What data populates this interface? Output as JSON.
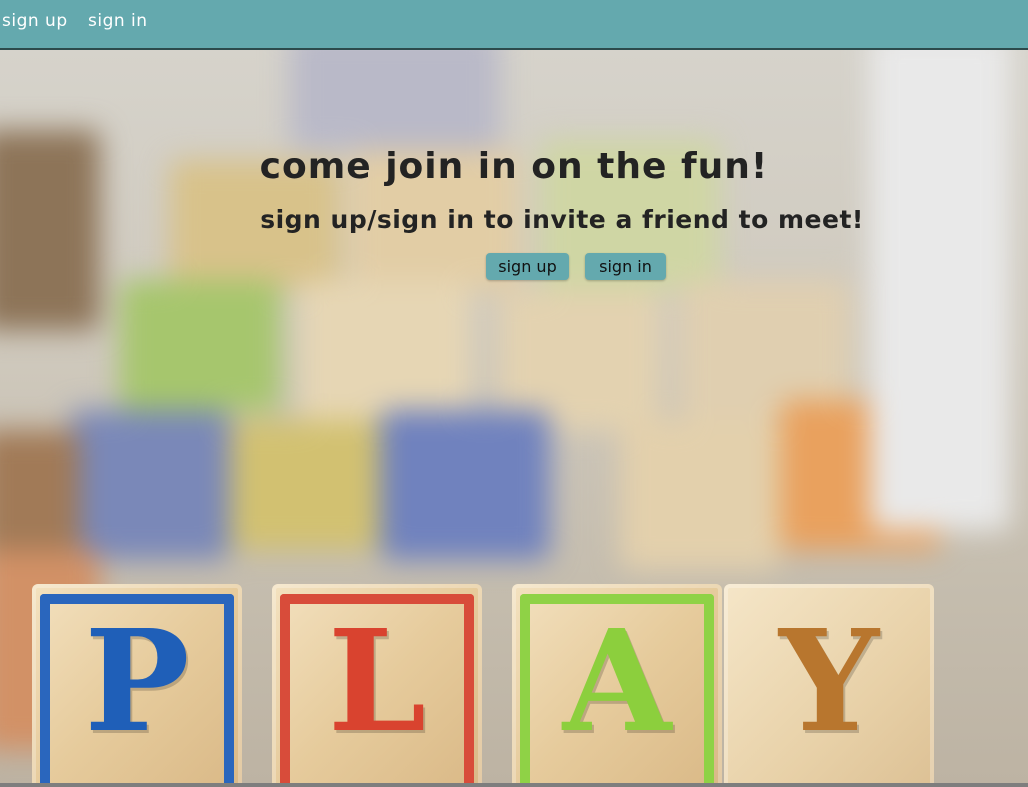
{
  "navbar": {
    "links": [
      {
        "label": "SIGN UP"
      },
      {
        "label": "SIGN IN"
      }
    ],
    "background_color": "#64a9ae"
  },
  "hero": {
    "headline": "COME JOIN IN ON THE FUN!",
    "subheadline": "SIGN UP/SIGN IN TO INVITE A FRIEND TO MEET!",
    "buttons": [
      {
        "label": "SIGN UP"
      },
      {
        "label": "SIGN IN"
      }
    ],
    "button_color": "#64a9ae",
    "background_image": {
      "description_letters": [
        "P",
        "L",
        "A",
        "Y"
      ],
      "letter_colors": [
        "#1f5fb8",
        "#d9432f",
        "#8ccf3d",
        "#b8762e"
      ]
    }
  }
}
